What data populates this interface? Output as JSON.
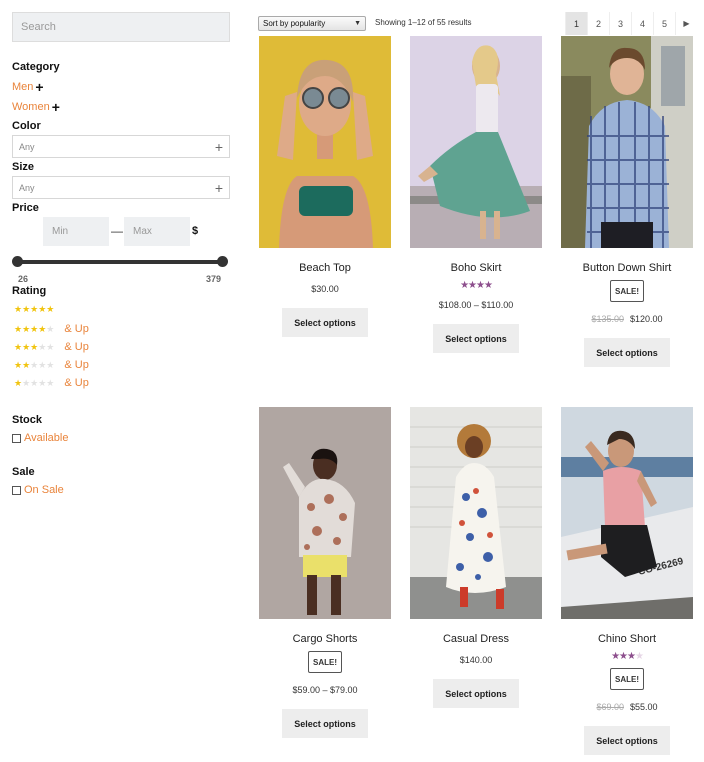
{
  "sidebar": {
    "search": {
      "placeholder": "Search"
    },
    "category": {
      "title": "Category",
      "items": [
        {
          "label": "Men"
        },
        {
          "label": "Women"
        }
      ]
    },
    "color": {
      "title": "Color",
      "value": "Any"
    },
    "size": {
      "title": "Size",
      "value": "Any"
    },
    "price": {
      "title": "Price",
      "min_placeholder": "Min",
      "max_placeholder": "Max",
      "dash": "—",
      "currency": "$",
      "range_min": "26",
      "range_max": "379"
    },
    "rating": {
      "title": "Rating",
      "items": [
        {
          "stars": 5,
          "suffix": ""
        },
        {
          "stars": 4,
          "suffix": "& Up"
        },
        {
          "stars": 3,
          "suffix": "& Up"
        },
        {
          "stars": 2,
          "suffix": "& Up"
        },
        {
          "stars": 1,
          "suffix": "& Up"
        }
      ]
    },
    "stock": {
      "title": "Stock",
      "option": "Available"
    },
    "sale": {
      "title": "Sale",
      "option": "On Sale"
    }
  },
  "toolbar": {
    "sort_value": "Sort by popularity",
    "result_count": "Showing 1–12 of 55 results",
    "pages": [
      "1",
      "2",
      "3",
      "4",
      "5"
    ],
    "current_page": "1",
    "next_icon": "chevron-right-icon"
  },
  "products": [
    {
      "name": "Beach Top",
      "price": "$30.00",
      "old_price": "",
      "sale": false,
      "rating": 0,
      "button": "Select options",
      "image": "woman-sunglasses-photo"
    },
    {
      "name": "Boho Skirt",
      "price": "$108.00 – $110.00",
      "old_price": "",
      "sale": false,
      "rating": 4,
      "button": "Select options",
      "image": "woman-green-skirt-photo"
    },
    {
      "name": "Button Down Shirt",
      "price": "$120.00",
      "old_price": "$135.00",
      "sale": true,
      "sale_label": "SALE!",
      "rating": 0,
      "button": "Select options",
      "image": "man-plaid-shirt-photo"
    },
    {
      "name": "Cargo Shorts",
      "price": "$59.00 – $79.00",
      "old_price": "",
      "sale": true,
      "sale_label": "SALE!",
      "rating": 0,
      "button": "Select options",
      "image": "woman-yellow-shorts-photo"
    },
    {
      "name": "Casual Dress",
      "price": "$140.00",
      "old_price": "",
      "sale": false,
      "rating": 0,
      "button": "Select options",
      "image": "woman-floral-dress-photo"
    },
    {
      "name": "Chino Short",
      "price": "$55.00",
      "old_price": "$69.00",
      "sale": true,
      "sale_label": "SALE!",
      "rating": 3,
      "button": "Select options",
      "image": "man-boat-photo"
    }
  ],
  "colors": {
    "accent_orange": "#e9843b",
    "star_yellow": "#f1c40f",
    "rating_purple": "#8d4f8d",
    "button_bg": "#ededed"
  }
}
